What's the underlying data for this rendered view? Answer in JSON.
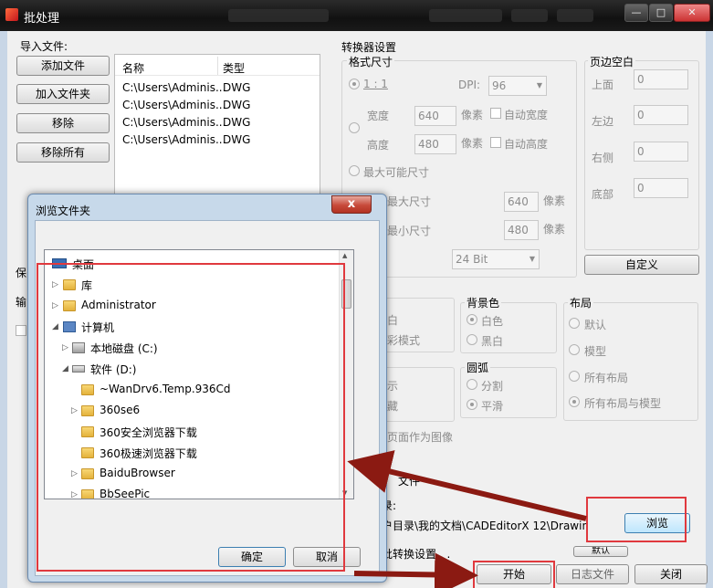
{
  "window": {
    "title": "批处理",
    "buttons": {
      "minimize": "—",
      "maximize": "□",
      "close": "✕"
    }
  },
  "import": {
    "group_label": "导入文件:",
    "add_file": "添加文件",
    "add_folder": "加入文件夹",
    "remove": "移除",
    "remove_all": "移除所有",
    "columns": [
      "名称",
      "类型"
    ],
    "rows": [
      [
        "C:\\Users\\Adminis...",
        "DWG"
      ],
      [
        "C:\\Users\\Adminis...",
        "DWG"
      ],
      [
        "C:\\Users\\Adminis...",
        "DWG"
      ],
      [
        "C:\\Users\\Adminis...",
        "DWG"
      ]
    ]
  },
  "left_partial": {
    "save_label": "保",
    "output_label": "输"
  },
  "converter": {
    "title": "转换器设置",
    "format_size": "格式尺寸",
    "ratio_label": "1 : 1",
    "dpi_label": "DPI:",
    "dpi_value": "96",
    "width_label": "宽度",
    "width_value": "640",
    "height_label": "高度",
    "height_value": "480",
    "pixel_unit": "像素",
    "auto_width": "自动宽度",
    "auto_height": "自动高度",
    "max_possible": "最大可能尺寸",
    "max_size": "最大尺寸",
    "max_value": "640",
    "min_size": "最小尺寸",
    "min_value": "480",
    "bit_depth": "24 Bit",
    "margin_title": "页边空白",
    "margin_top": "上面",
    "margin_left": "左边",
    "margin_right": "右侧",
    "margin_bottom": "底部",
    "margin_top_value": "0",
    "margin_left_value": "0",
    "margin_right_value": "0",
    "margin_bottom_value": "0",
    "custom_button": "自定义"
  },
  "options": {
    "partial_a": "白",
    "partial_b": "彩模式",
    "bg_title": "背景色",
    "bg_white": "白色",
    "bg_black": "黑白",
    "layout_title": "布局",
    "layout_default": "默认",
    "layout_model": "模型",
    "layout_all": "所有布局",
    "layout_all_model": "所有布局与模型",
    "arc_title": "圆弧",
    "arc_segment": "分割",
    "arc_smooth": "平滑",
    "partial_c": "示",
    "partial_d": "藏",
    "page_as_image": "页面作为图像",
    "partial_file": "文件"
  },
  "output": {
    "dir_label": "录:",
    "path": "户目录\\我的文档\\CADEditorX 12\\Drawings\\",
    "browse": "浏览",
    "batch_settings": "批转换设置 . .",
    "default_button": "默认"
  },
  "footer": {
    "start": "开始",
    "log": "日志文件",
    "close": "关闭"
  },
  "dialog": {
    "title": "浏览文件夹",
    "close": "x",
    "ok": "确定",
    "cancel": "取消",
    "tree": [
      {
        "label": "桌面",
        "icon": "desktop-icon",
        "level": 0,
        "toggle": ""
      },
      {
        "label": "库",
        "icon": "library-icon",
        "level": 1,
        "toggle": "▷"
      },
      {
        "label": "Administrator",
        "icon": "user-folder-icon",
        "level": 1,
        "toggle": "▷"
      },
      {
        "label": "计算机",
        "icon": "computer-icon",
        "level": 1,
        "toggle": "◢"
      },
      {
        "label": "本地磁盘 (C:)",
        "icon": "drive-c-icon",
        "level": 2,
        "toggle": "▷"
      },
      {
        "label": "软件 (D:)",
        "icon": "drive-d-icon",
        "level": 2,
        "toggle": "◢"
      },
      {
        "label": "~WanDrv6.Temp.936Cd",
        "icon": "folder-icon",
        "level": 3,
        "toggle": ""
      },
      {
        "label": "360se6",
        "icon": "folder-icon",
        "level": 3,
        "toggle": "▷"
      },
      {
        "label": "360安全浏览器下载",
        "icon": "folder-icon",
        "level": 3,
        "toggle": ""
      },
      {
        "label": "360极速浏览器下载",
        "icon": "folder-icon",
        "level": 3,
        "toggle": ""
      },
      {
        "label": "BaiduBrowser",
        "icon": "folder-icon",
        "level": 3,
        "toggle": "▷"
      },
      {
        "label": "BbSeePic",
        "icon": "folder-icon",
        "level": 3,
        "toggle": "▷"
      }
    ]
  },
  "colors": {
    "annotation_red": "#e0393e",
    "arrow_dark_red": "#8b1a12"
  }
}
